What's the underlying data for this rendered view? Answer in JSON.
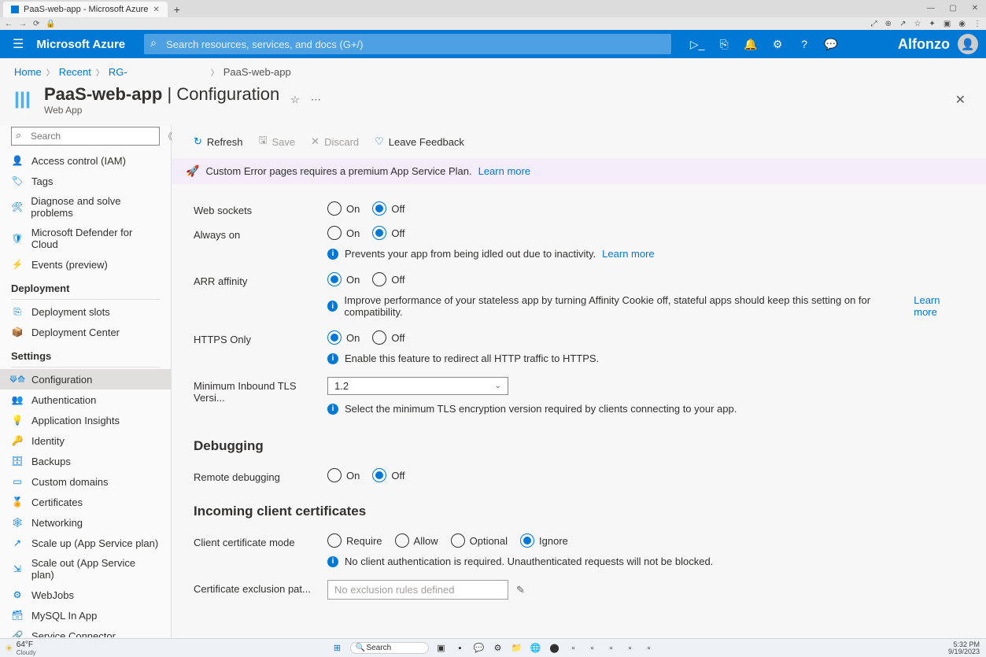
{
  "browser": {
    "tab_title": "PaaS-web-app - Microsoft Azure",
    "new_tab": "+"
  },
  "window_controls": {
    "min": "—",
    "max": "▢",
    "close": "✕"
  },
  "header": {
    "product": "Microsoft Azure",
    "search_placeholder": "Search resources, services, and docs (G+/)",
    "user_name": "Alfonzo"
  },
  "breadcrumb": {
    "items": [
      "Home",
      "Recent",
      "RG-"
    ],
    "current": "PaaS-web-app"
  },
  "title": {
    "resource": "PaaS-web-app",
    "page": "Configuration",
    "subtitle": "Web App"
  },
  "sidebar": {
    "search_placeholder": "Search",
    "top_items": [
      {
        "label": "Access control (IAM)",
        "icon": "👤",
        "color": "#0078d4"
      },
      {
        "label": "Tags",
        "icon": "🏷",
        "color": "#0078d4"
      },
      {
        "label": "Diagnose and solve problems",
        "icon": "🛠",
        "color": "#0078d4"
      },
      {
        "label": "Microsoft Defender for Cloud",
        "icon": "🛡",
        "color": "#0078d4"
      },
      {
        "label": "Events (preview)",
        "icon": "⚡",
        "color": "#f2c811"
      }
    ],
    "groups": [
      {
        "heading": "Deployment",
        "items": [
          {
            "label": "Deployment slots",
            "icon": "⎘",
            "color": "#0078d4"
          },
          {
            "label": "Deployment Center",
            "icon": "📦",
            "color": "#0078d4"
          }
        ]
      },
      {
        "heading": "Settings",
        "items": [
          {
            "label": "Configuration",
            "icon": "⟱⟰",
            "color": "#0078d4",
            "selected": true
          },
          {
            "label": "Authentication",
            "icon": "👥",
            "color": "#0078d4"
          },
          {
            "label": "Application Insights",
            "icon": "💡",
            "color": "#8661c5"
          },
          {
            "label": "Identity",
            "icon": "🔑",
            "color": "#f2c811"
          },
          {
            "label": "Backups",
            "icon": "🗄",
            "color": "#0078d4"
          },
          {
            "label": "Custom domains",
            "icon": "▭",
            "color": "#0078d4"
          },
          {
            "label": "Certificates",
            "icon": "🏅",
            "color": "#d83b01"
          },
          {
            "label": "Networking",
            "icon": "🕸",
            "color": "#0078d4"
          },
          {
            "label": "Scale up (App Service plan)",
            "icon": "↗",
            "color": "#0078d4"
          },
          {
            "label": "Scale out (App Service plan)",
            "icon": "⇲",
            "color": "#0078d4"
          },
          {
            "label": "WebJobs",
            "icon": "⚙",
            "color": "#0078d4"
          },
          {
            "label": "MySQL In App",
            "icon": "🗃",
            "color": "#0078d4"
          },
          {
            "label": "Service Connector",
            "icon": "🔗",
            "color": "#605e5c"
          }
        ]
      }
    ]
  },
  "cmdbar": {
    "refresh": "Refresh",
    "save": "Save",
    "discard": "Discard",
    "feedback": "Leave Feedback"
  },
  "banner": {
    "text": "Custom Error pages requires a premium App Service Plan.",
    "link": "Learn more"
  },
  "radios": {
    "on": "On",
    "off": "Off",
    "require": "Require",
    "allow": "Allow",
    "optional": "Optional",
    "ignore": "Ignore"
  },
  "settings": {
    "web_sockets": {
      "label": "Web sockets",
      "value": "Off"
    },
    "always_on": {
      "label": "Always on",
      "value": "Off",
      "help": "Prevents your app from being idled out due to inactivity.",
      "help_link": "Learn more"
    },
    "arr_affinity": {
      "label": "ARR affinity",
      "value": "On",
      "help": "Improve performance of your stateless app by turning Affinity Cookie off, stateful apps should keep this setting on for compatibility.",
      "help_link": "Learn more"
    },
    "https_only": {
      "label": "HTTPS Only",
      "value": "On",
      "help": "Enable this feature to redirect all HTTP traffic to HTTPS."
    },
    "min_tls": {
      "label": "Minimum Inbound TLS Versi...",
      "value": "1.2",
      "help": "Select the minimum TLS encryption version required by clients connecting to your app."
    },
    "debugging_heading": "Debugging",
    "remote_debugging": {
      "label": "Remote debugging",
      "value": "Off"
    },
    "client_cert_heading": "Incoming client certificates",
    "client_cert_mode": {
      "label": "Client certificate mode",
      "value": "Ignore",
      "help": "No client authentication is required. Unauthenticated requests will not be blocked."
    },
    "cert_exclusion": {
      "label": "Certificate exclusion pat...",
      "placeholder": "No exclusion rules defined"
    }
  },
  "taskbar": {
    "weather_temp": "64°F",
    "weather_desc": "Cloudy",
    "search": "Search",
    "time": "5:32 PM",
    "date": "9/19/2023"
  }
}
